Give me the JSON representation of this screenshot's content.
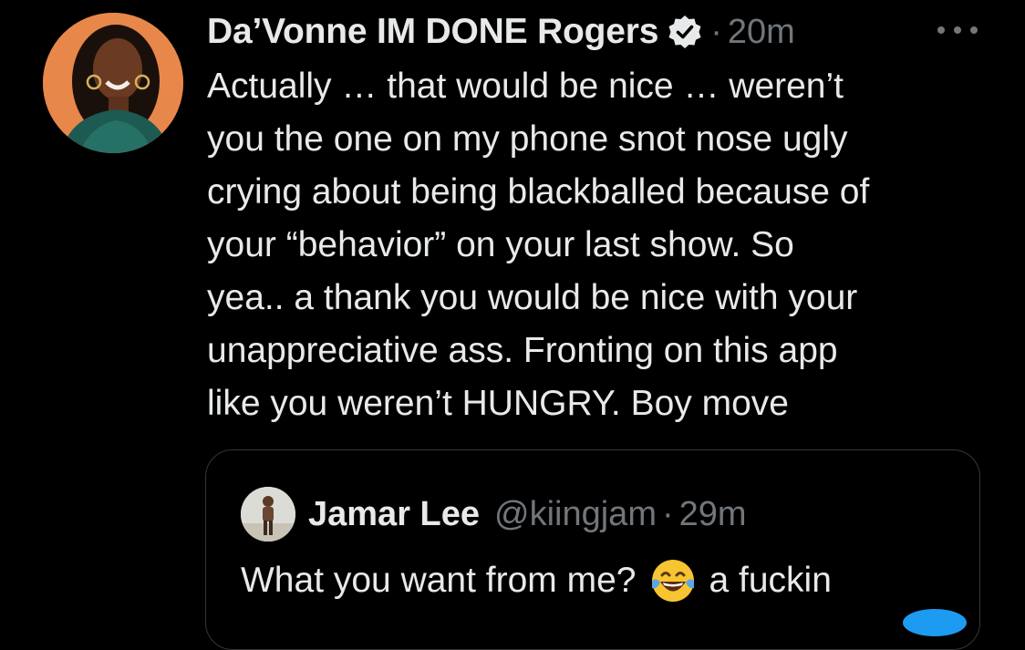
{
  "tweet": {
    "author": {
      "display_name": "Da’Vonne IM DONE Rogers",
      "verified_icon": "verified-badge-icon",
      "avatar": "profile-photo"
    },
    "dot": "·",
    "timestamp": "20m",
    "more_icon": "more-options-icon",
    "text": "Actually … that would be nice … weren’t\nyou the one on my phone snot nose ugly\ncrying about being blackballed because of\nyour “behavior” on your last show. So\nyea.. a thank you would be nice with your\nunappreciative ass. Fronting on this app\nlike you weren’t HUNGRY. Boy move"
  },
  "quoted_tweet": {
    "display_name": "Jamar Lee",
    "handle": "@kiingjam",
    "dot": "·",
    "timestamp": "29m",
    "text_before_emoji": "What you want from me?",
    "emoji_icon": "face-with-tears-of-joy-emoji",
    "text_after_emoji": "a fuckin"
  },
  "colors": {
    "background": "#000000",
    "primary_text": "#e7e9ea",
    "secondary_text": "#71767b",
    "border": "#333639",
    "accent": "#1d9bf0"
  }
}
